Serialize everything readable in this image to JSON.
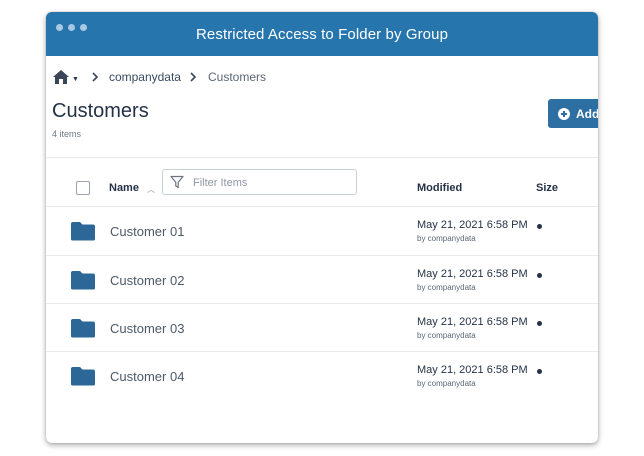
{
  "window": {
    "title": "Restricted Access to Folder by Group"
  },
  "breadcrumb": {
    "parent": "companydata",
    "current": "Customers"
  },
  "page": {
    "title": "Customers",
    "item_count": "4 items"
  },
  "toolbar": {
    "add_label": "Add"
  },
  "table": {
    "headers": {
      "name": "Name",
      "modified": "Modified",
      "size": "Size"
    },
    "filter_placeholder": "Filter Items",
    "rows": [
      {
        "name": "Customer 01",
        "modified": "May 21, 2021 6:58 PM",
        "by": "by companydata"
      },
      {
        "name": "Customer 02",
        "modified": "May 21, 2021 6:58 PM",
        "by": "by companydata"
      },
      {
        "name": "Customer 03",
        "modified": "May 21, 2021 6:58 PM",
        "by": "by companydata"
      },
      {
        "name": "Customer 04",
        "modified": "May 21, 2021 6:58 PM",
        "by": "by companydata"
      }
    ]
  },
  "icons": {
    "home": "home-icon",
    "dropdown": "caret-down-icon",
    "separator": "chevron-right-icon",
    "add": "plus-circle-icon",
    "filter": "filter-icon",
    "sort": "sort-caret-icon",
    "folder": "folder-icon"
  },
  "colors": {
    "titlebar": "#2675ad",
    "accent": "#2d6fa3",
    "folder": "#2d6797",
    "text": "#253246"
  }
}
